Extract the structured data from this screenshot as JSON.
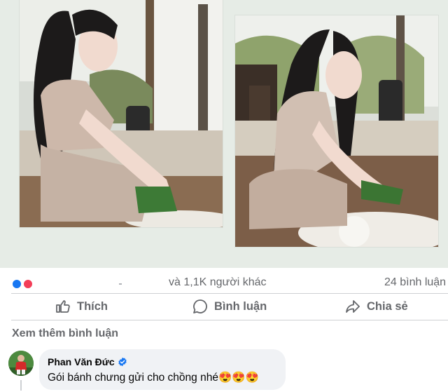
{
  "post": {
    "images": [
      {
        "name": "photo-left",
        "alt": ""
      },
      {
        "name": "photo-right",
        "alt": ""
      }
    ]
  },
  "stats": {
    "others_text": "và 1,1K người khác",
    "comments_text": "24 bình luận"
  },
  "actions": {
    "like_label": "Thích",
    "comment_label": "Bình luận",
    "share_label": "Chia sẻ"
  },
  "comments": {
    "view_more_label": "Xem thêm bình luận",
    "items": [
      {
        "author": "Phan Văn Đức",
        "verified": true,
        "text": "Gói bánh chưng gửi cho chồng nhé😍😍😍"
      }
    ]
  },
  "colors": {
    "secondary_text": "#65676b",
    "bubble_bg": "#f0f2f5",
    "verified_blue": "#1877f2",
    "like_blue": "#1877f2",
    "love_red": "#f33e58"
  },
  "icons": {
    "like": "thumbs-up-icon",
    "comment": "speech-bubble-icon",
    "share": "share-arrow-icon",
    "verified": "verified-badge-icon"
  }
}
